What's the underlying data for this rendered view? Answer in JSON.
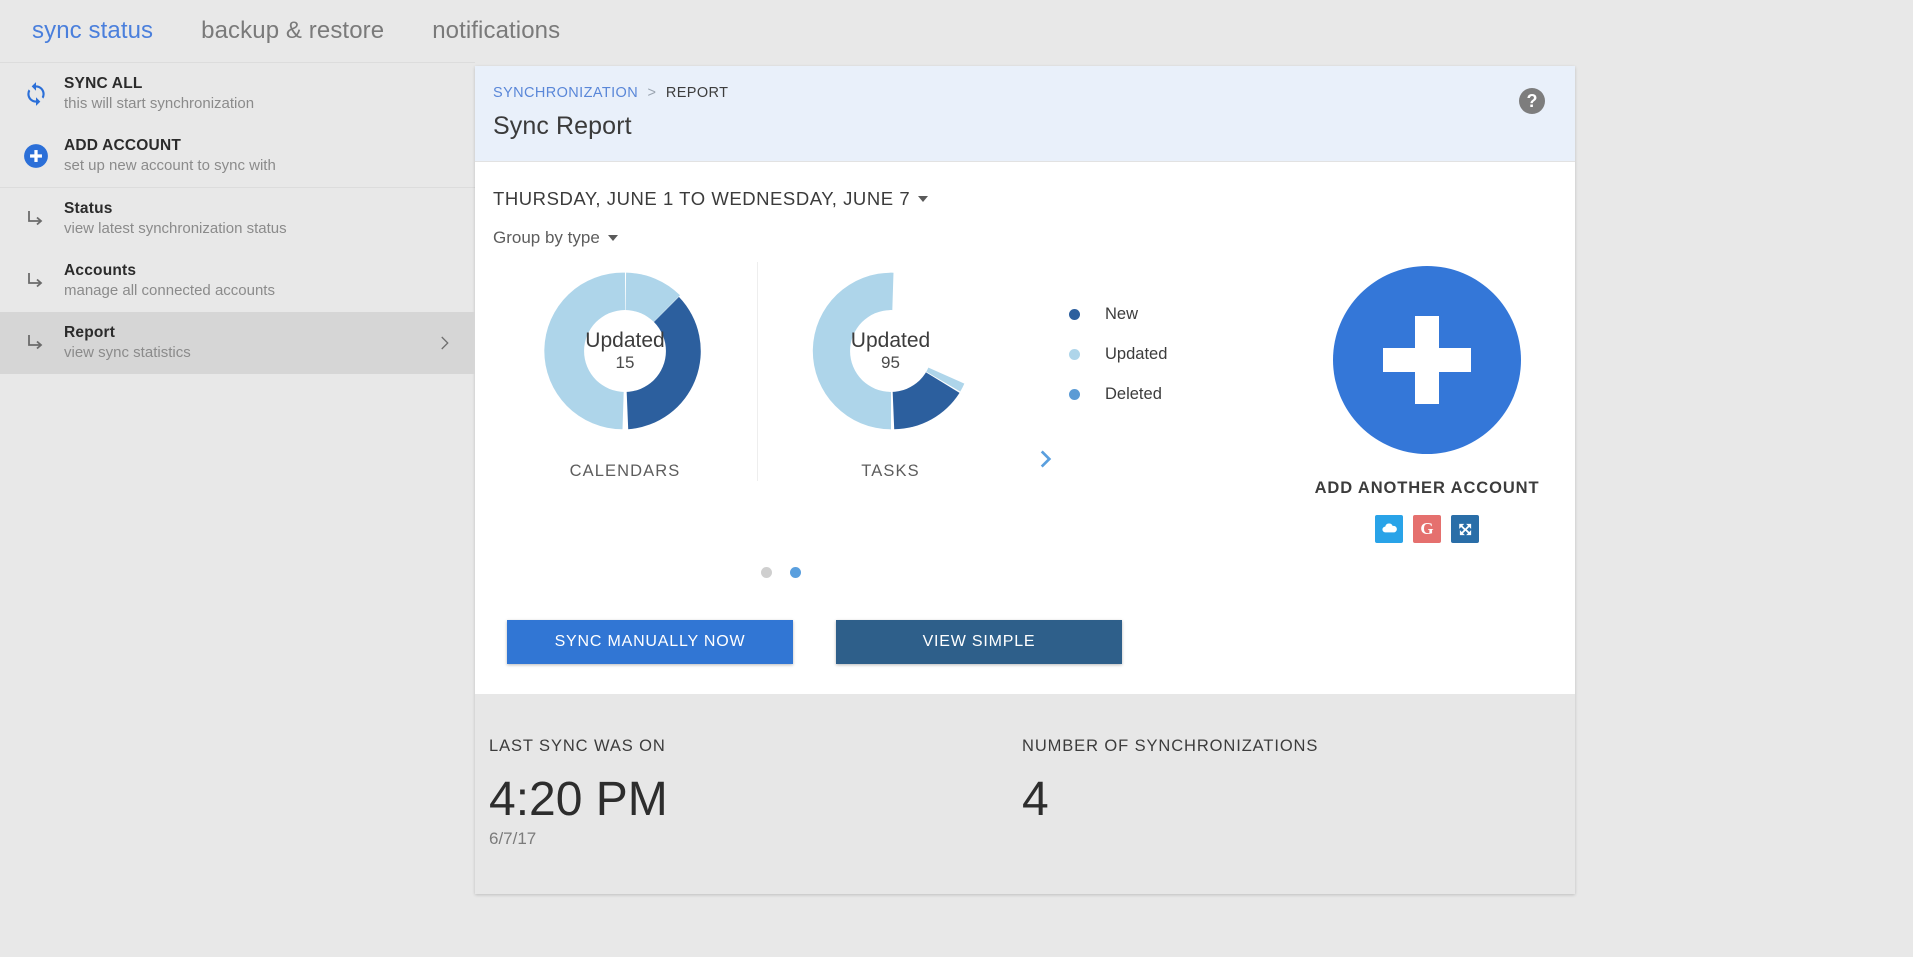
{
  "topbar": {
    "tabs": [
      {
        "label": "sync status",
        "active": true
      },
      {
        "label": "backup & restore",
        "active": false
      },
      {
        "label": "notifications",
        "active": false
      }
    ]
  },
  "sidebar": {
    "group1": [
      {
        "icon": "sync-icon",
        "title": "SYNC ALL",
        "sub": "this will start synchronization"
      },
      {
        "icon": "add-circle-icon",
        "title": "ADD ACCOUNT",
        "sub": "set up new account to sync with"
      }
    ],
    "group2": [
      {
        "icon": "arrow-branch-icon",
        "title": "Status",
        "sub": "view latest synchronization status",
        "selected": false
      },
      {
        "icon": "arrow-branch-icon",
        "title": "Accounts",
        "sub": "manage all connected accounts",
        "selected": false
      },
      {
        "icon": "arrow-branch-icon",
        "title": "Report",
        "sub": "view sync statistics",
        "selected": true
      }
    ]
  },
  "card": {
    "breadcrumb": {
      "root": "SYNCHRONIZATION",
      "separator": ">",
      "current": "REPORT"
    },
    "title": "Sync Report",
    "help_icon": "help-question-icon",
    "date_range": "THURSDAY, JUNE 1 TO WEDNESDAY, JUNE 7",
    "group_by": "Group by type",
    "buttons": {
      "primary": "SYNC MANUALLY NOW",
      "secondary": "VIEW SIMPLE"
    },
    "add_account": {
      "caption": "ADD ANOTHER ACCOUNT",
      "plus_icon": "plus-icon",
      "providers": [
        {
          "name": "cloud-provider-icon",
          "glyph": "☁",
          "color": "#29a3e8"
        },
        {
          "name": "google-provider-icon",
          "glyph": "G",
          "color": "#e5706e"
        },
        {
          "name": "exchange-provider-icon",
          "glyph": "⌘",
          "color": "#2a6ea8"
        }
      ]
    },
    "carousel": {
      "next_icon": "chevron-right-icon",
      "dots": [
        {
          "active": false
        },
        {
          "active": true
        }
      ]
    }
  },
  "chart_data": {
    "type": "pie",
    "title": "Sync Report",
    "legend_position": "right",
    "legend": [
      {
        "name": "New",
        "color": "#2c5f9e"
      },
      {
        "name": "Updated",
        "color": "#aed5ea"
      },
      {
        "name": "Deleted",
        "color": "#5b9bd5"
      }
    ],
    "charts": [
      {
        "caption": "CALENDARS",
        "center_label": "Updated",
        "center_value": "15",
        "categories": [
          "New",
          "Updated",
          "Deleted"
        ],
        "values": [
          8,
          15,
          0.3
        ]
      },
      {
        "caption": "TASKS",
        "center_label": "Updated",
        "center_value": "95",
        "categories": [
          "New",
          "Updated",
          "Deleted"
        ],
        "values": [
          14,
          95,
          0.8
        ]
      }
    ]
  },
  "footer": {
    "stats": [
      {
        "label": "LAST SYNC WAS ON",
        "value": "4:20 PM",
        "sub": "6/7/17"
      },
      {
        "label": "NUMBER OF SYNCHRONIZATIONS",
        "value": "4",
        "sub": ""
      }
    ]
  }
}
